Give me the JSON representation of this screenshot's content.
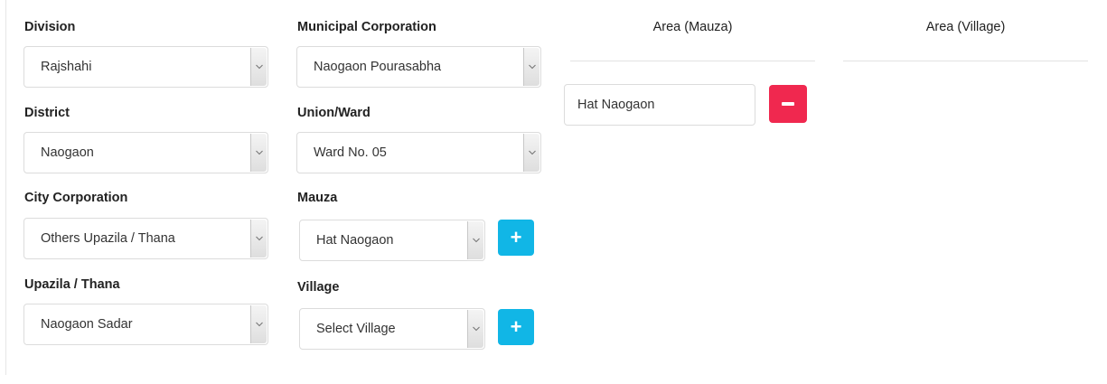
{
  "fields": {
    "division": {
      "label": "Division",
      "value": "Rajshahi"
    },
    "district": {
      "label": "District",
      "value": "Naogaon"
    },
    "city_corporation": {
      "label": "City Corporation",
      "value": "Others Upazila / Thana"
    },
    "upazila_thana": {
      "label": "Upazila / Thana",
      "value": "Naogaon Sadar"
    },
    "municipal_corporation": {
      "label": "Municipal Corporation",
      "value": "Naogaon Pourasabha"
    },
    "union_ward": {
      "label": "Union/Ward",
      "value": "Ward No. 05"
    },
    "mauza": {
      "label": "Mauza",
      "value": "Hat Naogaon"
    },
    "village": {
      "label": "Village",
      "value": "Select Village"
    }
  },
  "area_table": {
    "mauza_header": "Area (Mauza)",
    "village_header": "Area (Village)",
    "mauza_entries": [
      "Hat Naogaon"
    ]
  },
  "colors": {
    "add_button": "#11b6e6",
    "remove_button": "#f0284f"
  },
  "icons": {
    "add": "plus-icon",
    "remove": "minus-icon",
    "dropdown": "chevron-down-icon"
  }
}
